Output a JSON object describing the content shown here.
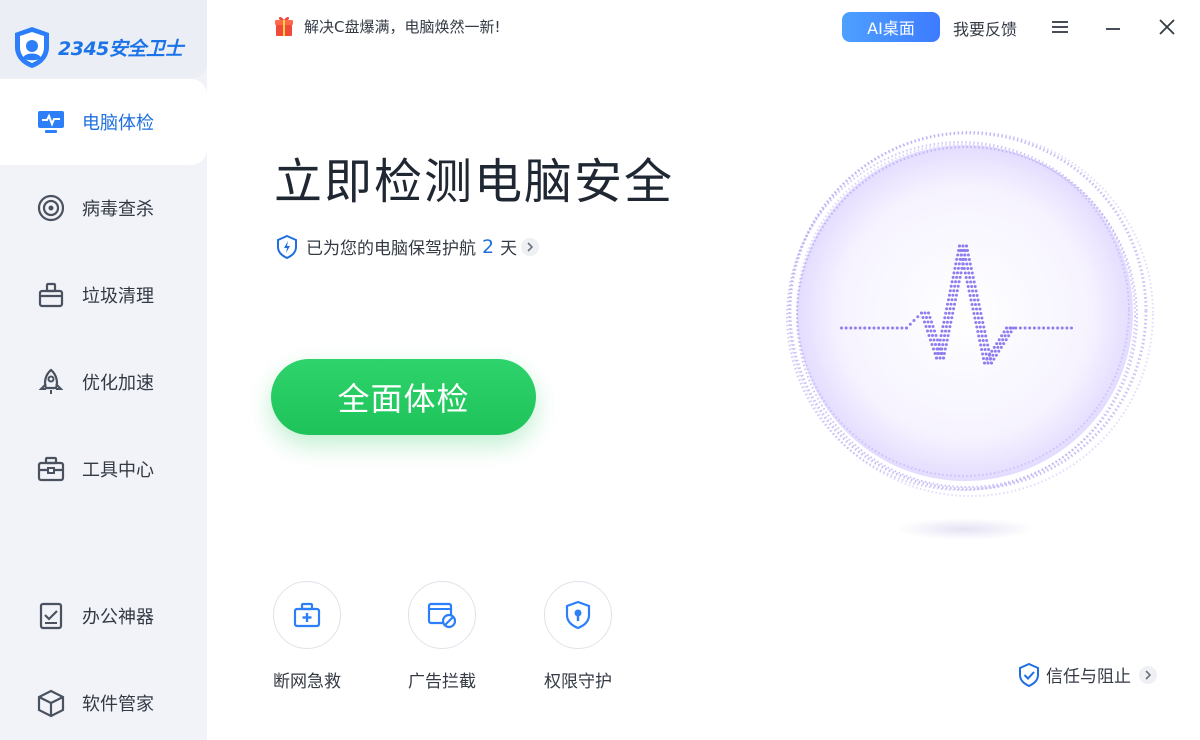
{
  "app": {
    "logo_text": "2345安全卫士",
    "promo": "解决C盘爆满，电脑焕然一新!",
    "ai_button": "AI桌面",
    "feedback": "我要反馈"
  },
  "sidebar": {
    "items": [
      {
        "label": "电脑体检",
        "icon": "monitor-pulse-icon",
        "active": true
      },
      {
        "label": "病毒查杀",
        "icon": "target-icon",
        "active": false
      },
      {
        "label": "垃圾清理",
        "icon": "trash-bin-icon",
        "active": false
      },
      {
        "label": "优化加速",
        "icon": "rocket-icon",
        "active": false
      },
      {
        "label": "工具中心",
        "icon": "toolbox-icon",
        "active": false
      },
      {
        "label": "办公神器",
        "icon": "checklist-icon",
        "active": false
      },
      {
        "label": "软件管家",
        "icon": "box-icon",
        "active": false
      }
    ]
  },
  "main": {
    "title": "立即检测电脑安全",
    "protect_prefix": "已为您的电脑保驾护航",
    "protect_days": "2",
    "protect_suffix": "天",
    "scan_button": "全面体检",
    "tools": [
      {
        "label": "断网急救",
        "icon": "first-aid-icon"
      },
      {
        "label": "广告拦截",
        "icon": "ad-block-icon"
      },
      {
        "label": "权限守护",
        "icon": "shield-key-icon"
      }
    ],
    "trust_link": "信任与阻止"
  },
  "colors": {
    "accent": "#1f6fe0",
    "scan_green": "#22c55e",
    "orb_purple": "#8f7df0"
  }
}
